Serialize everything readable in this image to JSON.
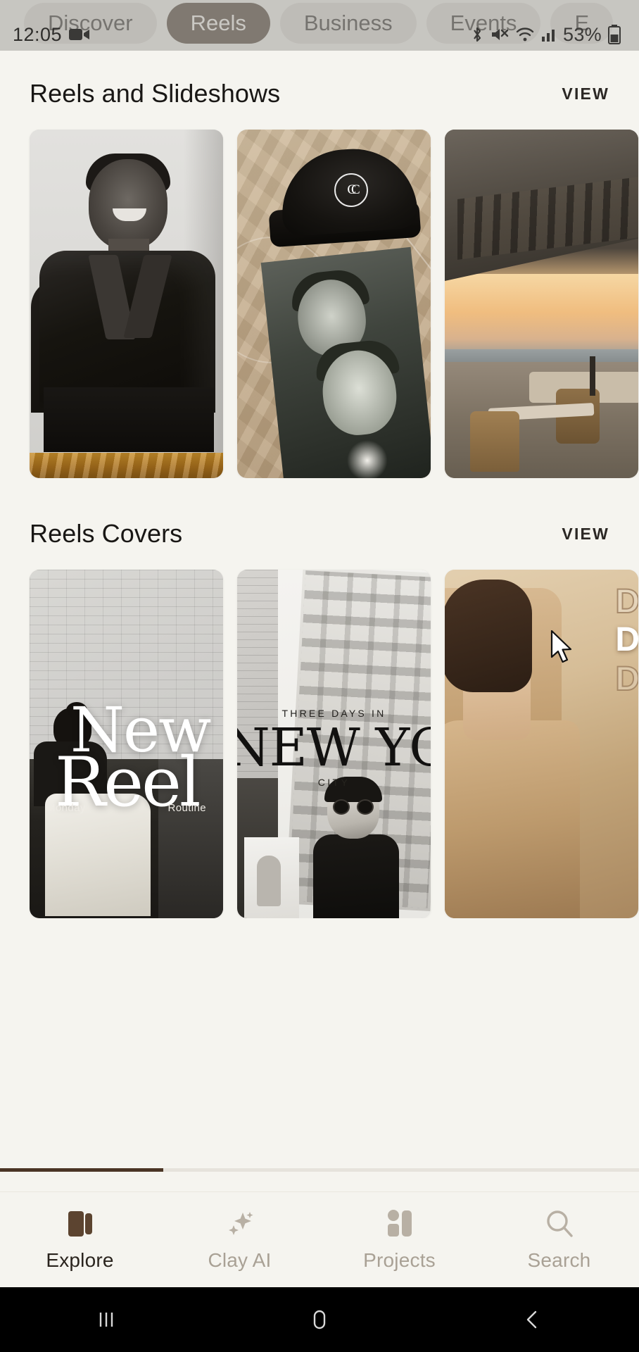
{
  "status_bar": {
    "time": "12:05",
    "battery_percent": "53%",
    "icons": [
      "screen-record-icon",
      "bluetooth-icon",
      "mute-icon",
      "wifi-icon",
      "signal-icon",
      "battery-icon"
    ]
  },
  "header": {
    "tabs": [
      {
        "label": "Discover",
        "active": false
      },
      {
        "label": "Reels",
        "active": true
      },
      {
        "label": "Business",
        "active": false
      },
      {
        "label": "Events",
        "active": false
      },
      {
        "label": "E",
        "active": false
      }
    ]
  },
  "sections": [
    {
      "title": "Reels and Slideshows",
      "view_label": "VIEW",
      "cards": [
        {
          "name": "laughing-man-leather-jacket",
          "caption": ""
        },
        {
          "name": "chanel-beanie-on-linen",
          "caption": ""
        },
        {
          "name": "sunset-rooftop-terrace",
          "caption": ""
        }
      ]
    },
    {
      "title": "Reels Covers",
      "view_label": "VIEW",
      "cards": [
        {
          "name": "new-reel-brick-wall-cover",
          "title_line1": "New",
          "title_line2": "Reel",
          "sub_left": "Monday",
          "sub_right": "Routine"
        },
        {
          "name": "new-york-editorial-cover",
          "kicker": "THREE DAYS IN",
          "title": "NEW YORK",
          "sub": "CITY"
        },
        {
          "name": "desert-dress-cover",
          "line1": "DE",
          "line2": "DE",
          "line3": "DE"
        }
      ]
    }
  ],
  "bottom_nav": {
    "items": [
      {
        "label": "Explore",
        "icon": "book-icon",
        "active": true
      },
      {
        "label": "Clay AI",
        "icon": "sparkles-icon",
        "active": false
      },
      {
        "label": "Projects",
        "icon": "grid-icon",
        "active": false
      },
      {
        "label": "Search",
        "icon": "search-icon",
        "active": false
      }
    ]
  },
  "android_nav": {
    "recents_label": "|||",
    "home_label": "home",
    "back_label": "back"
  },
  "colors": {
    "background": "#f5f4ef",
    "accent": "#4a3525",
    "chip_inactive": "#dedbd6",
    "chip_active": "#3a2a1d",
    "muted_text": "#a9a195"
  }
}
